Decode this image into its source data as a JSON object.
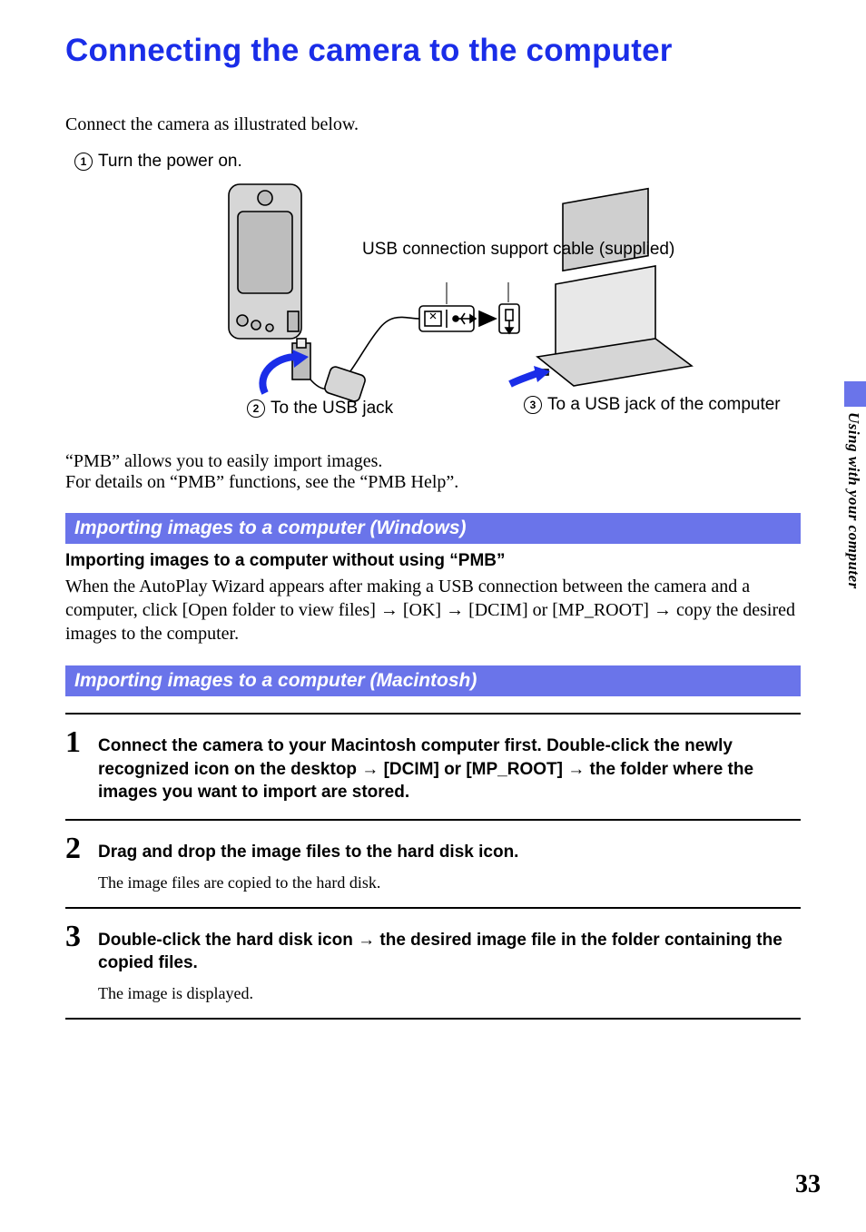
{
  "title": "Connecting the camera to the computer",
  "intro": "Connect the camera as illustrated below.",
  "callouts": {
    "power": {
      "num": "1",
      "text": "Turn the power on."
    },
    "usbjack": {
      "num": "2",
      "text": "To the USB jack"
    },
    "computerusb": {
      "num": "3",
      "text": "To a USB jack of the computer"
    },
    "cable": "USB connection support cable (supplied)"
  },
  "after1": "“PMB” allows you to easily import images.",
  "after2": "For details on “PMB” functions, see the “PMB Help”.",
  "section1": {
    "bar": "Importing images to a computer (Windows)",
    "subhead": "Importing images to a computer without using “PMB”",
    "para": "When the AutoPlay Wizard appears after making a USB connection between the camera and a computer, click [Open folder to view files] → [OK] → [DCIM] or [MP_ROOT] → copy the desired images to the computer."
  },
  "section2": {
    "bar": "Importing images to a computer (Macintosh)",
    "steps": [
      {
        "num": "1",
        "title": "Connect the camera to your Macintosh computer first. Double-click the newly recognized icon on the desktop → [DCIM] or [MP_ROOT] → the folder where the images you want to import are stored.",
        "desc": ""
      },
      {
        "num": "2",
        "title": "Drag and drop the image files to the hard disk icon.",
        "desc": "The image files are copied to the hard disk."
      },
      {
        "num": "3",
        "title": "Double-click the hard disk icon → the desired image file in the folder containing the copied files.",
        "desc": "The image is displayed."
      }
    ]
  },
  "sideTab": "Using with your computer",
  "pageNumber": "33"
}
